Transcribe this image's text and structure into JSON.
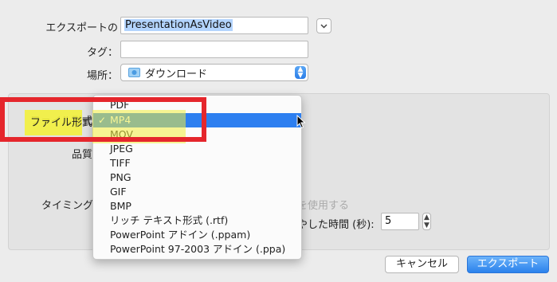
{
  "dialog": {
    "export_as_label": "エクスポートの",
    "export_as_value": "PresentationAsVideo",
    "tags_label": "タグ：",
    "tags_value": "",
    "where_label": "場所：",
    "where_value": "ダウンロード",
    "file_format_label": "ファイル形式",
    "quality_label_partial": "品質",
    "timing_label_partial": "タイミング",
    "use_timing_partial": "を使用する",
    "seconds_label_partial": "やした時間 (秒):",
    "seconds_value": "5",
    "cancel_button": "キャンセル",
    "export_button": "エクスポート"
  },
  "format_menu": {
    "selected": "MP4",
    "checkmark": "✓",
    "items": [
      "PDF",
      "MP4",
      "MOV",
      "JPEG",
      "TIFF",
      "PNG",
      "GIF",
      "BMP",
      "リッチ テキスト形式 (.rtf)",
      "PowerPoint アドイン (.ppam)",
      "PowerPoint 97-2003 アドイン (.ppa)"
    ]
  },
  "annotation": {
    "highlight_color": "#f2ef3c",
    "frame_color": "#e5262c"
  },
  "colors": {
    "accent": "#2d7ff0",
    "window_bg": "#ececec"
  }
}
